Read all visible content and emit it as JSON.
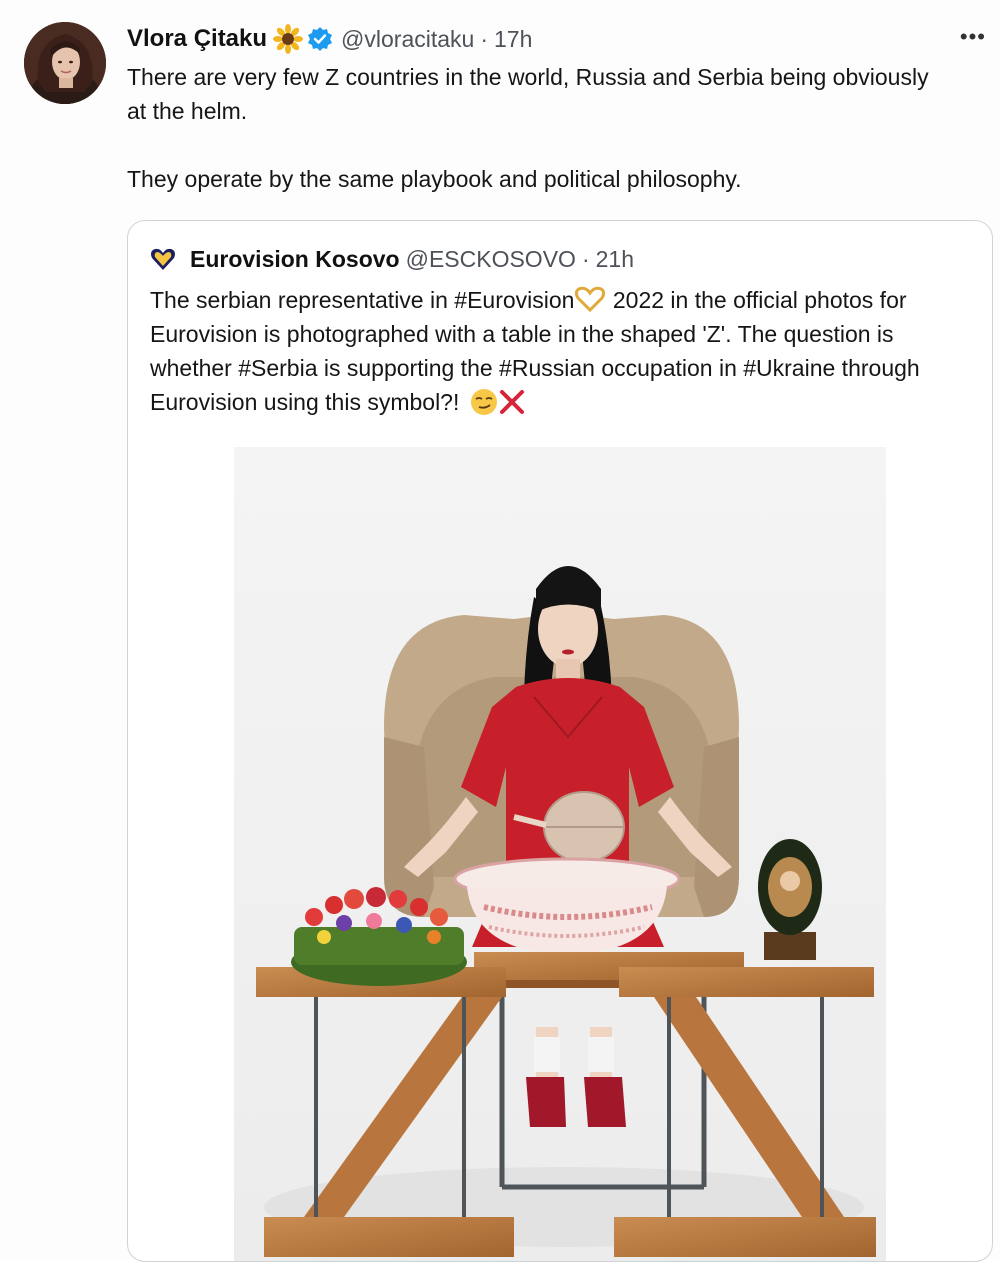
{
  "tweet": {
    "author_name": "Vlora Çitaku",
    "handle": "@vloracitaku",
    "separator": "·",
    "time": "17h",
    "more_label": "•••",
    "text_line1": "There are very few Z countries in the world, Russia and Serbia being obviously at the helm.",
    "text_line2": "They operate by the same playbook and political philosophy."
  },
  "quoted": {
    "author_name": "Eurovision Kosovo",
    "handle": "@ESCKOSOVO",
    "separator": "·",
    "time": "21h",
    "text_part1": "The serbian representative in #Eurovision",
    "text_part2": " 2022 in the official photos for Eurovision is photographed with a table in the shaped 'Z'. The question is whether #Serbia is supporting the #Russian occupation in #Ukraine through Eurovision using this symbol?! ",
    "icons": [
      "heart-emoji",
      "smirk-emoji",
      "cross-mark"
    ]
  },
  "colors": {
    "verified": "#1d9bf0",
    "dress": "#c8202a",
    "chair": "#c2a98a",
    "wood": "#b97a45",
    "heart_outline": "#e0a93a",
    "cross": "#d5253a"
  }
}
